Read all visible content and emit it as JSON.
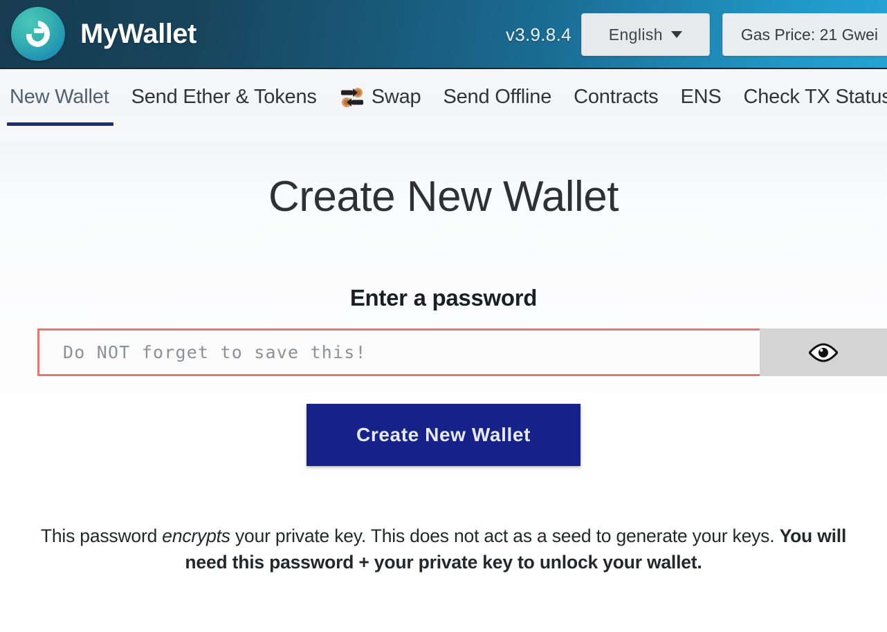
{
  "header": {
    "brand_title": "MyWallet",
    "logo_icon": "wallet-refresh-logo",
    "version": "v3.9.8.4",
    "language": {
      "selected": "English",
      "caret_icon": "chevron-down-icon"
    },
    "gas_price": "Gas Price: 21 Gwei",
    "gradient_from": "#173c50",
    "gradient_to": "#23a3d4"
  },
  "nav": {
    "active_index": 0,
    "active_underline_color": "#1b2f72",
    "items": [
      {
        "label": "New Wallet",
        "icon": null
      },
      {
        "label": "Send Ether & Tokens",
        "icon": null
      },
      {
        "label": "Swap",
        "icon": "swap-arrows-icon"
      },
      {
        "label": "Send Offline",
        "icon": null
      },
      {
        "label": "Contracts",
        "icon": null
      },
      {
        "label": "ENS",
        "icon": null
      },
      {
        "label": "Check TX Status",
        "icon": null
      }
    ]
  },
  "main": {
    "page_title": "Create New Wallet",
    "password_section_label": "Enter a password",
    "password_input": {
      "value": "",
      "placeholder": "Do NOT forget to save this!",
      "border_color": "#e8766b"
    },
    "toggle_visibility": {
      "icon": "eye-icon",
      "background": "#d4d4d4"
    },
    "create_button": {
      "label": "Create New Wallet",
      "background": "#16228a"
    },
    "footnote": {
      "part1": "This password ",
      "emphasis": "encrypts",
      "part2": " your private key. This does not act as a seed to generate your keys. ",
      "bold": "You will need this password + your private key to unlock your wallet."
    }
  }
}
